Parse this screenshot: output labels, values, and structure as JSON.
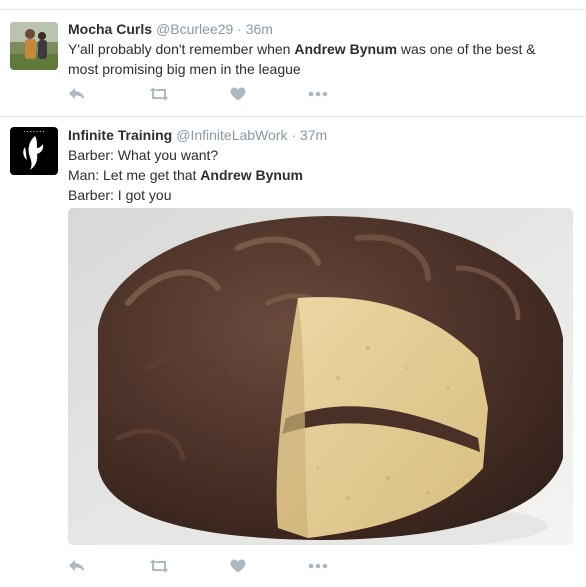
{
  "tweets": [
    {
      "name": "Mocha Curls",
      "handle": "@Bcurlee29",
      "separator": "·",
      "time": "36m",
      "text_before": "Y'all probably don't remember when ",
      "text_bold": "Andrew Bynum",
      "text_after": " was one of the best & most promising big men in the league",
      "icons": {
        "reply": "reply-icon",
        "retweet": "retweet-icon",
        "like": "heart-icon",
        "more": "more-icon"
      }
    },
    {
      "name": "Infinite Training",
      "handle": "@InfiniteLabWork",
      "separator": "·",
      "time": "37m",
      "lines": [
        {
          "text": "Barber: What you want?",
          "bold": ""
        },
        {
          "text": "Man: Let me get that ",
          "bold": "Andrew Bynum"
        },
        {
          "text": "Barber: I got you",
          "bold": ""
        }
      ],
      "media": "chocolate-frosted-layer-cake-photo",
      "icons": {
        "reply": "reply-icon",
        "retweet": "retweet-icon",
        "like": "heart-icon",
        "more": "more-icon"
      }
    }
  ],
  "colors": {
    "text": "#292f33",
    "secondary": "#8899a6",
    "icon": "#aab8c2",
    "divider": "#e1e8ed"
  }
}
